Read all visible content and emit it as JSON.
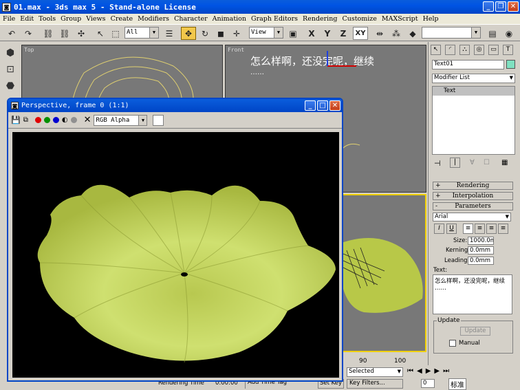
{
  "window": {
    "title": "01.max - 3ds max 5 - Stand-alone License",
    "icon": "max-app-icon"
  },
  "menu": [
    "File",
    "Edit",
    "Tools",
    "Group",
    "Views",
    "Create",
    "Modifiers",
    "Character",
    "Animation",
    "Graph Editors",
    "Rendering",
    "Customize",
    "MAXScript",
    "Help"
  ],
  "toolbar": {
    "selection_filter": "All",
    "ref_coord": "View",
    "axis_x": "X",
    "axis_y": "Y",
    "axis_z": "Z",
    "axis_xy": "XY",
    "named_selection": ""
  },
  "viewports": {
    "top_label": "Top",
    "front_label": "Front",
    "front_text_line1": "怎么样啊，还没完呢，继续",
    "front_text_line2": "……"
  },
  "render_window": {
    "title": "Perspective, frame 0 (1:1)",
    "channel": "RGB Alpha",
    "bg_color": "#000000",
    "object_color": "#c8d860"
  },
  "command_panel": {
    "object_name": "Text01",
    "name_color": "#7fe0c0",
    "modifier_list": "Modifier List",
    "stack_item": "Text",
    "rollouts": {
      "rendering": "Rendering",
      "interpolation": "Interpolation",
      "parameters": "Parameters"
    },
    "rollout_toggles": {
      "closed": "+",
      "open": "-"
    },
    "font": "Arial",
    "style_buttons": [
      "I",
      "U"
    ],
    "size_label": "Size:",
    "size_value": "1000.0m",
    "kerning_label": "Kerning:",
    "kerning_value": "0.0mm",
    "leading_label": "Leading:",
    "leading_value": "0.0mm",
    "text_label": "Text:",
    "text_value_line1": "怎么样啊，还没完呢，继续",
    "text_value_line2": "……",
    "update_group": "Update",
    "update_button": "Update",
    "manual_label": "Manual"
  },
  "timeline": {
    "tick_90": "90",
    "tick_100": "100"
  },
  "status": {
    "rendering_time_label": "Rendering Time",
    "rendering_time_value": "0:00:00",
    "add_time_tag": "Add Time Tag",
    "set_key": "Set Key",
    "key_filters": "Key Filters...",
    "selected": "Selected",
    "frame": "0",
    "ime_label": "标准"
  }
}
